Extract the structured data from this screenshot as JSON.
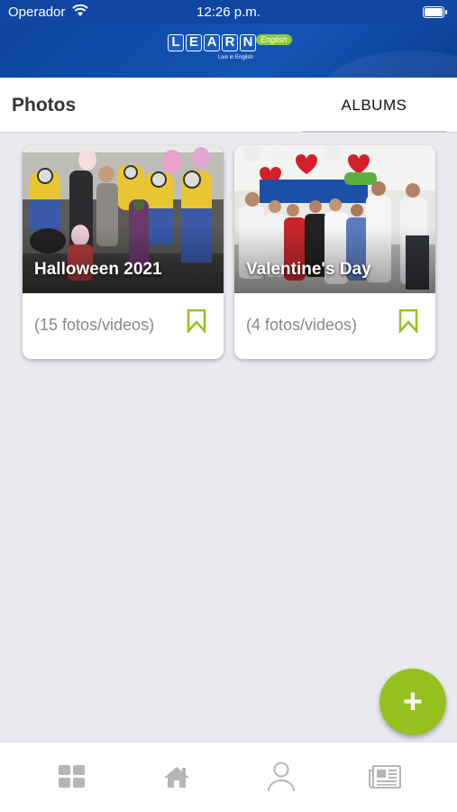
{
  "status_bar": {
    "carrier": "Operador",
    "time": "12:26 p.m.",
    "wifi_icon": "wifi-icon",
    "battery_icon": "battery-icon"
  },
  "brand": {
    "letters": [
      "L",
      "E",
      "A",
      "R",
      "N"
    ],
    "badge": "English",
    "tagline": "Live in English"
  },
  "header": {
    "title": "Photos",
    "tab_albums": "ALBUMS"
  },
  "albums": [
    {
      "title": "Halloween 2021",
      "count": "(15 fotos/videos)",
      "icon": "bookmark-icon"
    },
    {
      "title": "Valentine's Day",
      "count": "(4 fotos/videos)",
      "icon": "bookmark-icon"
    }
  ],
  "fab": {
    "label": "+",
    "icon": "plus-icon"
  },
  "bottom_nav": {
    "items": [
      {
        "icon": "grid-icon"
      },
      {
        "icon": "home-icon"
      },
      {
        "icon": "user-icon"
      },
      {
        "icon": "news-icon"
      }
    ]
  },
  "colors": {
    "brand_blue": "#0f47a3",
    "accent_green": "#94c11f",
    "background": "#e9e9ef"
  }
}
